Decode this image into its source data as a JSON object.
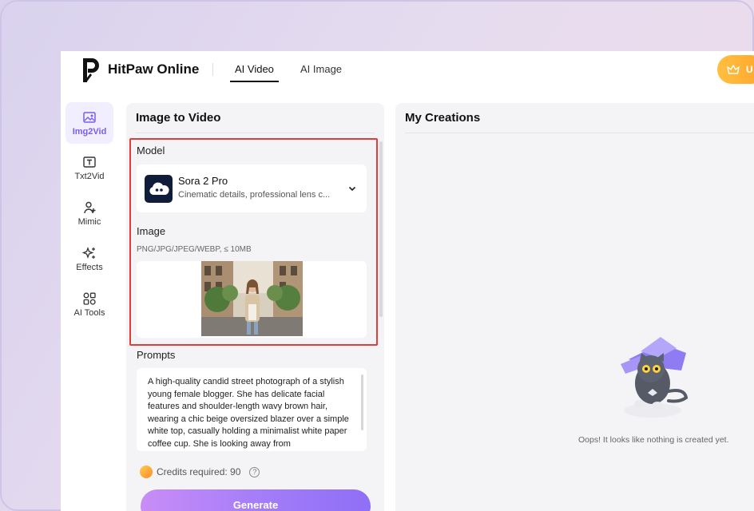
{
  "brand": {
    "name": "HitPaw Online",
    "logo_icon": "hitpaw-p-logo"
  },
  "nav": {
    "tabs": [
      {
        "label": "AI Video",
        "active": true
      },
      {
        "label": "AI Image",
        "active": false
      }
    ]
  },
  "upgrade": {
    "label": "U",
    "icon": "crown-icon"
  },
  "sidebar": {
    "items": [
      {
        "label": "Img2Vid",
        "icon": "image-icon",
        "active": true
      },
      {
        "label": "Txt2Vid",
        "icon": "text-icon",
        "active": false
      },
      {
        "label": "Mimic",
        "icon": "person-plus-icon",
        "active": false
      },
      {
        "label": "Effects",
        "icon": "sparkle-icon",
        "active": false
      },
      {
        "label": "AI Tools",
        "icon": "tools-grid-icon",
        "active": false
      }
    ]
  },
  "left_panel": {
    "title": "Image to Video",
    "model": {
      "label": "Model",
      "name": "Sora 2 Pro",
      "description": "Cinematic details, professional lens c...",
      "icon": "sora-cloud-icon"
    },
    "image": {
      "label": "Image",
      "hint": "PNG/JPG/JPEG/WEBP, ≤ 10MB"
    },
    "prompts": {
      "label": "Prompts",
      "text": "A high-quality candid street photograph of a stylish young female blogger. She has delicate facial features and shoulder-length wavy brown hair, wearing a chic beige oversized blazer over a simple white top, casually holding a minimalist white paper coffee cup. She is looking away from"
    },
    "credits": {
      "text": "Credits required: 90",
      "help": "?"
    },
    "generate_label": "Generate"
  },
  "right_panel": {
    "title": "My Creations",
    "empty_text": "Oops! It looks like nothing is created yet."
  },
  "colors": {
    "accent": "#7a5cf0",
    "highlight": "#e23c3c",
    "upgrade": "#ffb23a"
  }
}
